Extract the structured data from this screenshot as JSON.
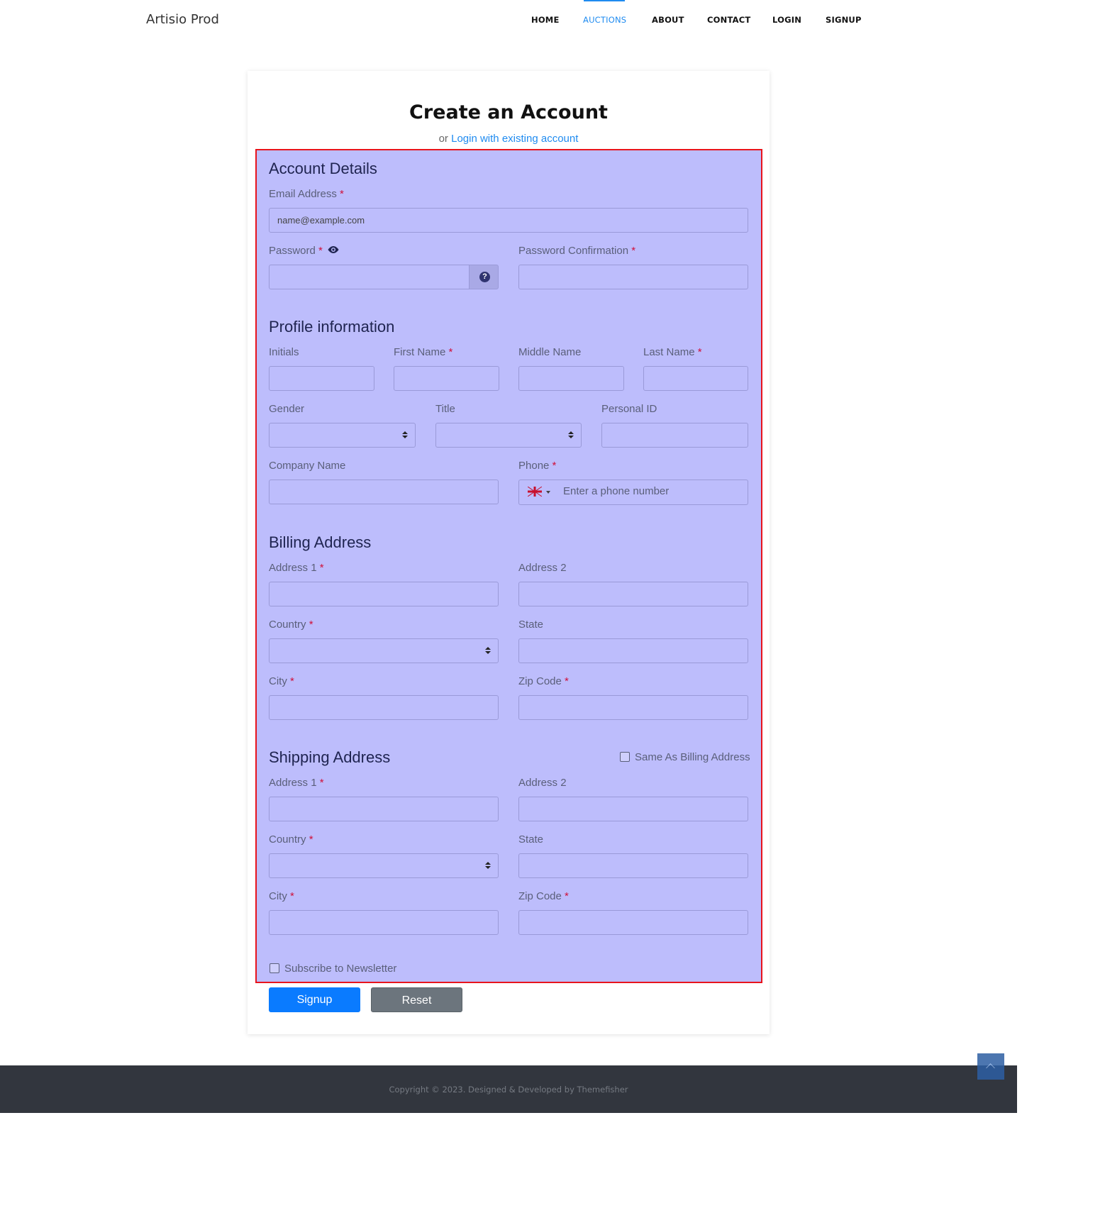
{
  "nav": {
    "brand": "Artisio Prod",
    "items": [
      "HOME",
      "AUCTIONS",
      "ABOUT",
      "CONTACT",
      "LOGIN",
      "SIGNUP"
    ],
    "active": "AUCTIONS"
  },
  "card": {
    "title": "Create an Account",
    "subtitle_prefix": "or",
    "login_link": "Login with existing account"
  },
  "account": {
    "heading": "Account Details",
    "email_label": "Email Address",
    "email_placeholder": "name@example.com",
    "password_label": "Password",
    "password_confirm_label": "Password Confirmation",
    "required_mark": "*"
  },
  "profile": {
    "heading": "Profile information",
    "initials_label": "Initials",
    "first_name_label": "First Name",
    "middle_name_label": "Middle Name",
    "last_name_label": "Last Name",
    "gender_label": "Gender",
    "title_label": "Title",
    "personal_id_label": "Personal ID",
    "company_label": "Company Name",
    "phone_label": "Phone",
    "phone_placeholder": "Enter a phone number"
  },
  "billing": {
    "heading": "Billing Address",
    "address1_label": "Address 1",
    "address2_label": "Address 2",
    "country_label": "Country",
    "state_label": "State",
    "city_label": "City",
    "zip_label": "Zip Code"
  },
  "shipping": {
    "heading": "Shipping Address",
    "same_as_billing": "Same As Billing Address",
    "address1_label": "Address 1",
    "address2_label": "Address 2",
    "country_label": "Country",
    "state_label": "State",
    "city_label": "City",
    "zip_label": "Zip Code"
  },
  "newsletter_label": "Subscribe to Newsletter",
  "buttons": {
    "signup": "Signup",
    "reset": "Reset"
  },
  "footer": {
    "copyright": "Copyright © 2023. Designed & Developed by Themefisher"
  },
  "colors": {
    "accent": "#1f8bf0",
    "highlight": "#bdbdfc",
    "highlight_border": "#e8141c",
    "footer_bg": "#32363e"
  }
}
